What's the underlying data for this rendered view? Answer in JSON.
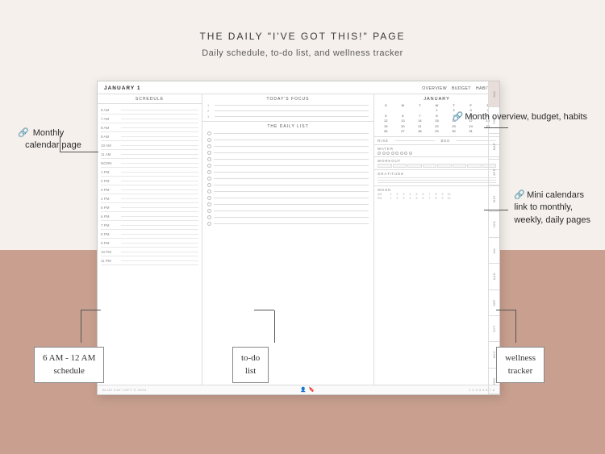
{
  "page": {
    "title": "THE DAILY \"I'VE GOT THIS!\" PAGE",
    "subtitle": "Daily schedule, to-do list, and wellness tracker"
  },
  "planner": {
    "date_label": "JANUARY 1",
    "tabs": [
      "OVERVIEW",
      "BUDGET",
      "HABITS"
    ],
    "schedule_label": "SCHEDULE",
    "focus_label": "TODAY'S FOCUS",
    "daily_list_label": "THE DAILY LIST",
    "schedule_times": [
      "6 AM",
      "7 AM",
      "8 AM",
      "9 AM",
      "10 AM",
      "11 AM",
      "NOON",
      "1 PM",
      "2 PM",
      "3 PM",
      "4 PM",
      "5 PM",
      "6 PM",
      "7 PM",
      "8 PM",
      "9 PM",
      "10 PM",
      "11 PM"
    ],
    "mini_cal_title": "JANUARY",
    "mini_cal_days": [
      "S",
      "M",
      "T",
      "W",
      "T",
      "F",
      "S"
    ],
    "mini_cal_dates": [
      [
        "",
        "",
        "",
        "1",
        "2",
        "3",
        "4"
      ],
      [
        "5",
        "6",
        "7",
        "8",
        "9",
        "10",
        "11"
      ],
      [
        "12",
        "13",
        "14",
        "15",
        "16",
        "17",
        "18"
      ],
      [
        "19",
        "20",
        "21",
        "22",
        "23",
        "24",
        "25"
      ],
      [
        "26",
        "27",
        "28",
        "29",
        "30",
        "31",
        ""
      ]
    ],
    "sections": {
      "rise": "RISE",
      "bed": "BED",
      "workout_label": "WORKOUT",
      "gratitude_label": "GRATITUDE",
      "mood_label": "MOOD"
    },
    "vertical_tabs": [
      "JAN",
      "FEB",
      "MAR",
      "APR",
      "MAY",
      "JUN",
      "JUL",
      "AUG",
      "SEP",
      "OCT",
      "NOV",
      "DEC"
    ],
    "footer_brand": "BLUE CAT LOFT © 2023",
    "footer_page_nums": [
      "1",
      "2",
      "3",
      "4",
      "5",
      "6",
      "7",
      "8"
    ]
  },
  "annotations": {
    "top_right": {
      "icon": "🔗",
      "text": "Month overview,\nbudget, habits"
    },
    "mid_right": {
      "icon": "🔗",
      "text": "Mini calendars\nlink to monthly,\nweekly, daily pages"
    },
    "left": {
      "icon": "🔗",
      "text": "Monthly\ncalendar page"
    },
    "bottom_left": {
      "label": "6 AM - 12 AM\nschedule"
    },
    "bottom_middle": {
      "label": "to-do\nlist"
    },
    "bottom_right": {
      "label": "wellness\ntracker"
    }
  },
  "colors": {
    "bg_top": "#f5f0eb",
    "bg_bottom": "#c9a090",
    "planner_bg": "#ffffff",
    "box_border": "#888888",
    "text_dark": "#2a2a2a",
    "text_mid": "#555555",
    "text_light": "#aaaaaa"
  }
}
